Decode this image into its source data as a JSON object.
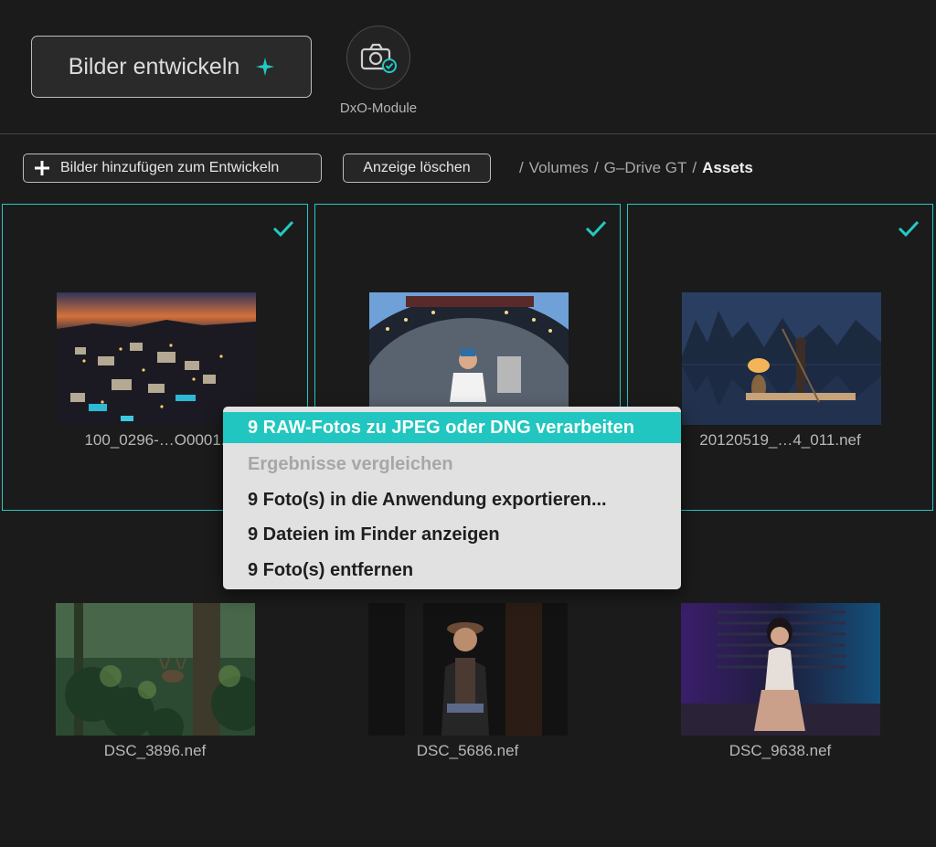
{
  "header": {
    "develop_button": "Bilder entwickeln",
    "dxo_module_label": "DxO-Module"
  },
  "toolbar": {
    "add_images": "Bilder hinzufügen zum Entwickeln",
    "clear_view": "Anzeige löschen"
  },
  "breadcrumb": [
    "Volumes",
    "G–Drive GT",
    "Assets"
  ],
  "photos": [
    {
      "filename": "100_0296-…O0001.",
      "selected": true,
      "scene": "night-town"
    },
    {
      "filename": "",
      "selected": true,
      "scene": "fisheye-cook"
    },
    {
      "filename": "20120519_…4_011.nef",
      "selected": true,
      "scene": "river-fisherman"
    },
    {
      "filename": "DSC_3896.nef",
      "selected": false,
      "scene": "forest-deer"
    },
    {
      "filename": "DSC_5686.nef",
      "selected": false,
      "scene": "old-man-portrait"
    },
    {
      "filename": "DSC_9638.nef",
      "selected": false,
      "scene": "neon-woman"
    }
  ],
  "context_menu": {
    "items": [
      {
        "label": "9 RAW-Fotos zu JPEG oder DNG verarbeiten",
        "state": "active"
      },
      {
        "label": "Ergebnisse vergleichen",
        "state": "disabled"
      },
      {
        "label": " 9 Foto(s) in die Anwendung exportieren...",
        "state": "normal"
      },
      {
        "label": "9 Dateien im Finder anzeigen",
        "state": "normal"
      },
      {
        "label": "9 Foto(s) entfernen",
        "state": "normal"
      }
    ]
  },
  "colors": {
    "accent": "#24c9c1",
    "background": "#1b1b1c",
    "menu_background": "#e1e1e1"
  }
}
